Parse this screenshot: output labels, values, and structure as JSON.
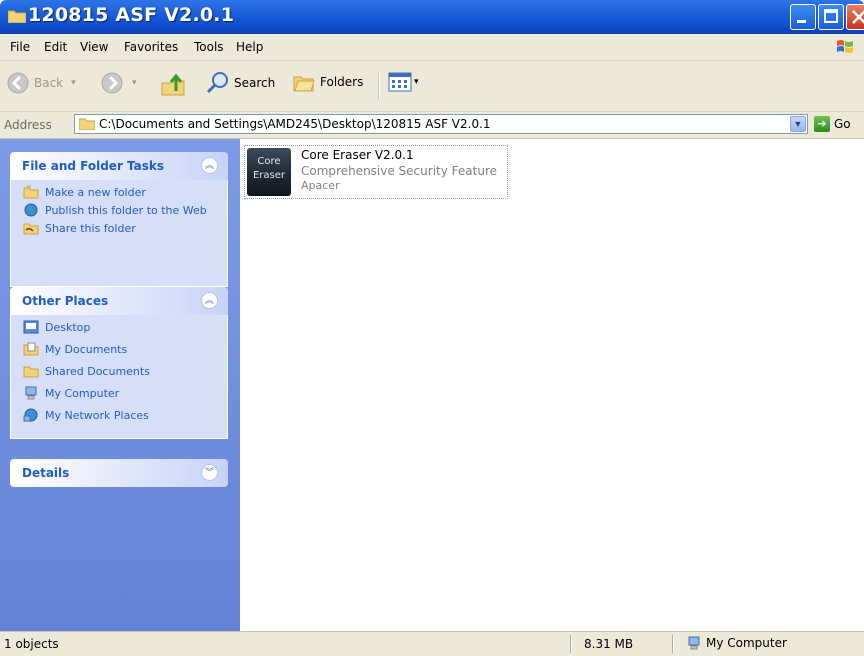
{
  "window": {
    "title": "120815 ASF V2.0.1"
  },
  "menu": {
    "items": [
      "File",
      "Edit",
      "View",
      "Favorites",
      "Tools",
      "Help"
    ]
  },
  "toolbar": {
    "back_label": "Back",
    "search_label": "Search",
    "folders_label": "Folders"
  },
  "address": {
    "label": "Address",
    "path": "C:\\Documents and Settings\\AMD245\\Desktop\\120815 ASF V2.0.1",
    "go_label": "Go"
  },
  "taskpane": {
    "file_tasks": {
      "title": "File and Folder Tasks",
      "items": [
        {
          "label": "Make a new folder",
          "icon": "new-folder-icon"
        },
        {
          "label": "Publish this folder to the Web",
          "icon": "publish-web-icon"
        },
        {
          "label": "Share this folder",
          "icon": "share-folder-icon"
        }
      ]
    },
    "other_places": {
      "title": "Other Places",
      "items": [
        {
          "label": "Desktop",
          "icon": "desktop-icon"
        },
        {
          "label": "My Documents",
          "icon": "my-documents-icon"
        },
        {
          "label": "Shared Documents",
          "icon": "shared-documents-icon"
        },
        {
          "label": "My Computer",
          "icon": "my-computer-icon"
        },
        {
          "label": "My Network Places",
          "icon": "network-places-icon"
        }
      ]
    },
    "details": {
      "title": "Details"
    }
  },
  "content": {
    "files": [
      {
        "name": "Core Eraser V2.0.1",
        "description": "Comprehensive Security Feature",
        "company": "Apacer",
        "icon_text_1": "Core",
        "icon_text_2": "Eraser"
      }
    ]
  },
  "status": {
    "objects": "1 objects",
    "size": "8.31 MB",
    "zone": "My Computer"
  },
  "colors": {
    "titlebar": "#0f4ccc",
    "taskpane": "#7c9be6",
    "task_link": "#215dc6",
    "chrome": "#ece9d8"
  }
}
